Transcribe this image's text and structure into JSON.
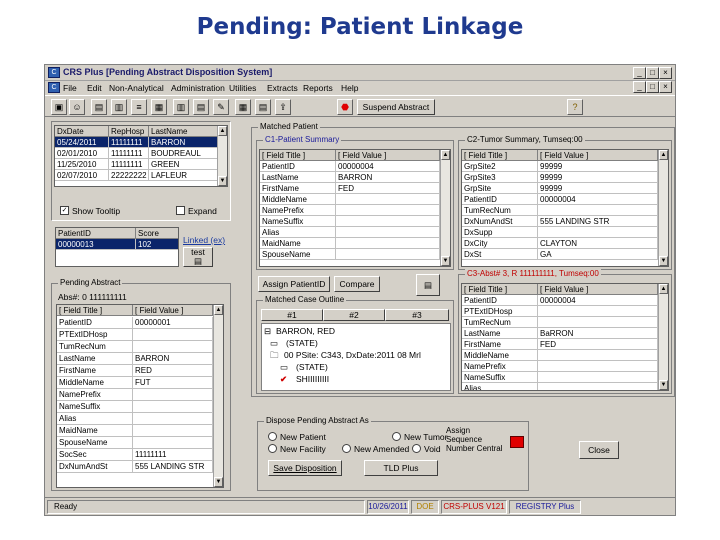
{
  "slide_title": "Pending: Patient Linkage",
  "window": {
    "title": "CRS Plus  [Pending Abstract Disposition System]",
    "controls": [
      "_",
      "□",
      "×"
    ],
    "mdi_controls": [
      "_",
      "□",
      "×"
    ]
  },
  "menu": [
    "File",
    "Edit",
    "Non-Analytical",
    "Administration",
    "Utilities",
    "Extracts",
    "Reports",
    "Help"
  ],
  "toolbar": {
    "suspend_label": "Suspend Abstract",
    "help_glyph": "?"
  },
  "case_list": {
    "headers": [
      "DxDate",
      "RepHosp",
      "LastName"
    ],
    "rows": [
      [
        "05/24/2011",
        "11111111",
        "BARRON"
      ],
      [
        "02/01/2010",
        "11111111",
        "BOUDREAUL"
      ],
      [
        "11/25/2010",
        "11111111",
        "GREEN"
      ],
      [
        "02/07/2010",
        "22222222",
        "LAFLEUR"
      ]
    ],
    "selected_index": 0,
    "show_tooltip_label": "Show Tooltip",
    "show_tooltip_checked": true,
    "expand_label": "Expand"
  },
  "patient_id_grid": {
    "headers": [
      "PatientID",
      "Score"
    ],
    "row": [
      "00000013",
      "102"
    ],
    "link_label": "Linked (ex)",
    "test_label": "test"
  },
  "pending_abstract": {
    "group_label": "Pending Abstract",
    "abs_label": "Abs#: 0 111111111",
    "headers": [
      "[ Field Title ]",
      "[ Field Value ]"
    ],
    "rows": [
      [
        "PatientID",
        "00000001"
      ],
      [
        "PTExtIDHosp",
        ""
      ],
      [
        "TumRecNum",
        ""
      ],
      [
        "LastName",
        "BARRON"
      ],
      [
        "FirstName",
        "RED"
      ],
      [
        "MiddleName",
        "FUT"
      ],
      [
        "NamePrefix",
        ""
      ],
      [
        "NameSuffix",
        ""
      ],
      [
        "Alias",
        ""
      ],
      [
        "MaidName",
        ""
      ],
      [
        "SpouseName",
        ""
      ],
      [
        "SocSec",
        "11111111"
      ],
      [
        "DxNumAndSt",
        "555 LANDING STR"
      ]
    ]
  },
  "matched_patient": {
    "group_label": "Matched Patient",
    "c1_label": "C1-Patient Summary",
    "c1_headers": [
      "[ Field Title ]",
      "[ Field Value ]"
    ],
    "c1_rows": [
      [
        "PatientID",
        "00000004"
      ],
      [
        "LastName",
        "BARRON"
      ],
      [
        "FirstName",
        "FED"
      ],
      [
        "MiddleName",
        ""
      ],
      [
        "NamePrefix",
        ""
      ],
      [
        "NameSuffix",
        ""
      ],
      [
        "Alias",
        ""
      ],
      [
        "MaidName",
        ""
      ],
      [
        "SpouseName",
        ""
      ]
    ],
    "c2_label": "C2-Tumor Summary, Tumseq:00",
    "c2_headers": [
      "[ Field Title ]",
      "[ Field Value ]"
    ],
    "c2_rows": [
      [
        "GrpSite2",
        "99999"
      ],
      [
        "GrpSite3",
        "99999"
      ],
      [
        "GrpSite",
        "99999"
      ],
      [
        "PatientID",
        "00000004"
      ],
      [
        "TumRecNum",
        ""
      ],
      [
        "DxNumAndSt",
        "555 LANDING STR"
      ],
      [
        "DxSupp",
        ""
      ],
      [
        "DxCity",
        "CLAYTON"
      ],
      [
        "DxSt",
        "GA"
      ]
    ],
    "c3_label": "C3-Abst# 3, R 111111111, Tumseq:00",
    "c3_headers": [
      "[ Field Title ]",
      "[ Field Value ]"
    ],
    "c3_rows": [
      [
        "PatientID",
        "00000004"
      ],
      [
        "PTExtIDHosp",
        ""
      ],
      [
        "TumRecNum",
        ""
      ],
      [
        "LastName",
        "BaRRON"
      ],
      [
        "FirstName",
        "FED"
      ],
      [
        "MiddleName",
        ""
      ],
      [
        "NamePrefix",
        ""
      ],
      [
        "NameSuffix",
        ""
      ],
      [
        "Alias",
        ""
      ]
    ],
    "assign_label": "Assign PatientID",
    "compare_label": "Compare",
    "outline_label": "Matched Case Outline",
    "outline_tabs": [
      "#1",
      "#2",
      "#3"
    ],
    "tree": [
      "BARRON, RED",
      "(STATE)",
      "00 PSite: C343, DxDate:2011 08 Mrl",
      "(STATE)",
      "SHIIIIIIIII"
    ]
  },
  "dispose": {
    "group_label": "Dispose Pending Abstract As",
    "options": [
      "New Patient",
      "New Tumor",
      "New Facility",
      "New Amended",
      "Void"
    ],
    "assign_label": "Assign Sequence Number Central",
    "save_label": "Save Disposition",
    "tld_label": "TLD Plus",
    "close_label": "Close"
  },
  "status": {
    "ready": "Ready",
    "date": "10/26/2011",
    "user": "DOE",
    "version": "CRS-PLUS  V121",
    "registry": "REGISTRY Plus"
  },
  "colors": {
    "title": "#1f3a8f",
    "selection": "#0a246a",
    "window": "#d4d0c8",
    "red_indicator": "#e00000"
  }
}
